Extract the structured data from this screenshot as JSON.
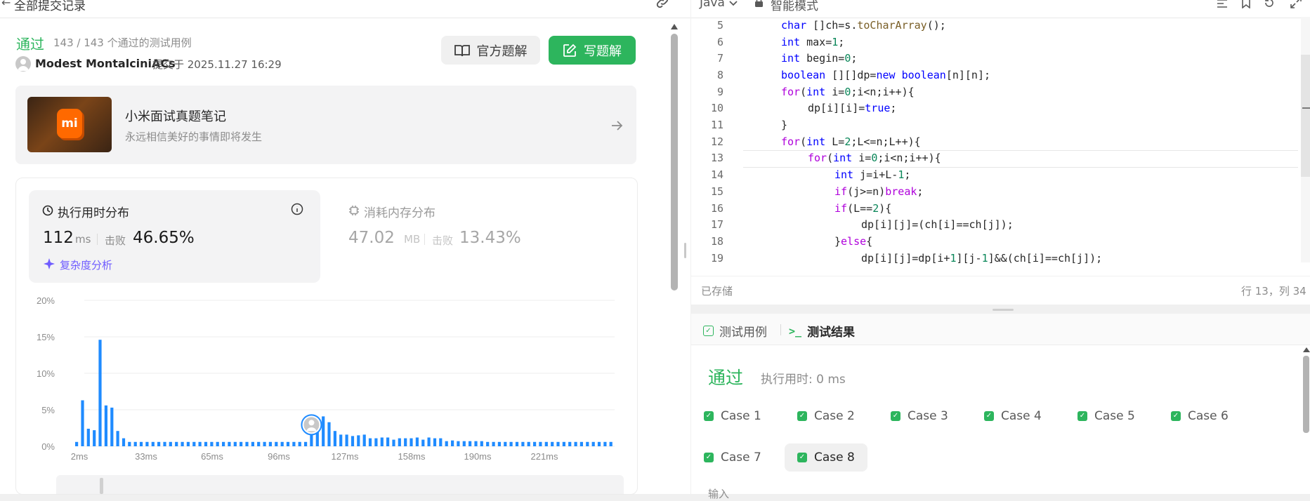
{
  "left_header": {
    "title": "全部提交记录"
  },
  "submission": {
    "status": "通过",
    "cases_summary": "143 / 143 个通过的测试用例",
    "user": "Modest MontalciniACs",
    "submitted_at": "提交于 2025.11.27 16:29",
    "official_solution_label": "官方题解",
    "write_solution_label": "写题解"
  },
  "promo": {
    "logo_text": "mi",
    "title": "小米面试真题笔记",
    "subtitle": "永远相信美好的事情即将发生"
  },
  "runtime": {
    "title": "执行用时分布",
    "value": "112",
    "unit": "ms",
    "beats_label": "击败",
    "beats_value": "46.65%",
    "complexity_label": "复杂度分析"
  },
  "memory": {
    "title": "消耗内存分布",
    "value": "47.02",
    "unit": "MB",
    "beats_label": "击败",
    "beats_value": "13.43%"
  },
  "chart_data": {
    "type": "bar",
    "title": "",
    "xlabel": "",
    "ylabel": "",
    "ylim": [
      0,
      20
    ],
    "y_ticks": [
      "0%",
      "5%",
      "10%",
      "15%",
      "20%"
    ],
    "x_ticks": [
      "2ms",
      "33ms",
      "65ms",
      "96ms",
      "127ms",
      "158ms",
      "190ms",
      "221ms"
    ],
    "values": [
      0.6,
      6.3,
      2.4,
      2.2,
      14.6,
      5.6,
      5.3,
      2.1,
      1.1,
      0.6,
      0.6,
      0.6,
      0.6,
      0.6,
      0.6,
      0.6,
      0.6,
      0.6,
      0.6,
      0.6,
      0.6,
      0.6,
      0.6,
      0.6,
      0.6,
      0.6,
      0.6,
      0.6,
      0.6,
      0.6,
      0.6,
      0.6,
      0.6,
      0.6,
      0.6,
      0.6,
      0.6,
      0.6,
      0.6,
      0.6,
      1.6,
      2.6,
      4.1,
      3.3,
      2.1,
      1.6,
      1.6,
      1.4,
      1.5,
      1.6,
      1.1,
      1.1,
      1.2,
      1.2,
      0.9,
      1.1,
      1.1,
      1.1,
      1.2,
      0.9,
      1.2,
      1.1,
      1.1,
      0.7,
      0.8,
      0.7,
      0.7,
      0.7,
      0.7,
      0.7,
      0.6,
      0.6,
      0.6,
      0.6,
      0.6,
      0.6,
      0.6,
      0.6,
      0.6,
      0.6,
      0.6,
      0.6,
      0.6,
      0.6,
      0.6,
      0.6,
      0.6,
      0.6,
      0.6,
      0.6,
      0.6,
      0.6
    ],
    "highlight_index": 40,
    "bar_color": "#1f8bff",
    "grid": true
  },
  "editor": {
    "language": "Java",
    "mode": "智能模式",
    "saved_label": "已存储",
    "cursor_position": "行 13，列 34",
    "lines": [
      {
        "n": "5",
        "indent": 2,
        "tokens": [
          [
            "kw",
            "char"
          ],
          [
            "t",
            " []ch=s."
          ],
          [
            "fn",
            "toCharArray"
          ],
          [
            "t",
            "();"
          ]
        ]
      },
      {
        "n": "6",
        "indent": 2,
        "tokens": [
          [
            "kw",
            "int"
          ],
          [
            "t",
            " max="
          ],
          [
            "num",
            "1"
          ],
          [
            "t",
            ";"
          ]
        ]
      },
      {
        "n": "7",
        "indent": 2,
        "tokens": [
          [
            "kw",
            "int"
          ],
          [
            "t",
            " begin="
          ],
          [
            "num",
            "0"
          ],
          [
            "t",
            ";"
          ]
        ]
      },
      {
        "n": "8",
        "indent": 2,
        "tokens": [
          [
            "kw",
            "boolean"
          ],
          [
            "t",
            " [][]dp="
          ],
          [
            "kw",
            "new"
          ],
          [
            "t",
            " "
          ],
          [
            "kw",
            "boolean"
          ],
          [
            "t",
            "[n][n];"
          ]
        ]
      },
      {
        "n": "9",
        "indent": 2,
        "tokens": [
          [
            "kw2",
            "for"
          ],
          [
            "t",
            "("
          ],
          [
            "kw",
            "int"
          ],
          [
            "t",
            " i="
          ],
          [
            "num",
            "0"
          ],
          [
            "t",
            ";i<n;i++){"
          ]
        ]
      },
      {
        "n": "10",
        "indent": 3,
        "tokens": [
          [
            "t",
            "dp[i][i]="
          ],
          [
            "kw",
            "true"
          ],
          [
            "t",
            ";"
          ]
        ]
      },
      {
        "n": "11",
        "indent": 2,
        "tokens": [
          [
            "t",
            "}"
          ]
        ]
      },
      {
        "n": "12",
        "indent": 2,
        "tokens": [
          [
            "kw2",
            "for"
          ],
          [
            "t",
            "("
          ],
          [
            "kw",
            "int"
          ],
          [
            "t",
            " L="
          ],
          [
            "num",
            "2"
          ],
          [
            "t",
            ";L<=n;L++){"
          ]
        ]
      },
      {
        "n": "13",
        "indent": 3,
        "tokens": [
          [
            "kw2",
            "for"
          ],
          [
            "t",
            "("
          ],
          [
            "kw",
            "int"
          ],
          [
            "t",
            " i="
          ],
          [
            "num",
            "0"
          ],
          [
            "t",
            ";i<n;i++){"
          ]
        ]
      },
      {
        "n": "14",
        "indent": 4,
        "tokens": [
          [
            "kw",
            "int"
          ],
          [
            "t",
            " j=i+L-"
          ],
          [
            "num",
            "1"
          ],
          [
            "t",
            ";"
          ]
        ]
      },
      {
        "n": "15",
        "indent": 4,
        "tokens": [
          [
            "kw2",
            "if"
          ],
          [
            "t",
            "(j>=n)"
          ],
          [
            "kw2",
            "break"
          ],
          [
            "t",
            ";"
          ]
        ]
      },
      {
        "n": "16",
        "indent": 4,
        "tokens": [
          [
            "kw2",
            "if"
          ],
          [
            "t",
            "(L=="
          ],
          [
            "num",
            "2"
          ],
          [
            "t",
            "){"
          ]
        ]
      },
      {
        "n": "17",
        "indent": 5,
        "tokens": [
          [
            "t",
            "dp[i][j]=(ch[i]==ch[j]);"
          ]
        ]
      },
      {
        "n": "18",
        "indent": 4,
        "tokens": [
          [
            "t",
            "}"
          ],
          [
            "kw2",
            "else"
          ],
          [
            "t",
            "{"
          ]
        ]
      },
      {
        "n": "19",
        "indent": 5,
        "tokens": [
          [
            "t",
            "dp[i][j]=dp[i+"
          ],
          [
            "num",
            "1"
          ],
          [
            "t",
            "][j-"
          ],
          [
            "num",
            "1"
          ],
          [
            "t",
            "]&&(ch[i]==ch[j]);"
          ]
        ]
      }
    ]
  },
  "results": {
    "tab_testcases": "测试用例",
    "tab_results": "测试结果",
    "status": "通过",
    "runtime": "执行用时: 0 ms",
    "cases": [
      "Case 1",
      "Case 2",
      "Case 3",
      "Case 4",
      "Case 5",
      "Case 6",
      "Case 7",
      "Case 8"
    ],
    "input_label": "输入"
  },
  "colors": {
    "accent_green": "#2db55d",
    "bar_blue": "#1f8bff",
    "purple": "#6f5cff"
  }
}
